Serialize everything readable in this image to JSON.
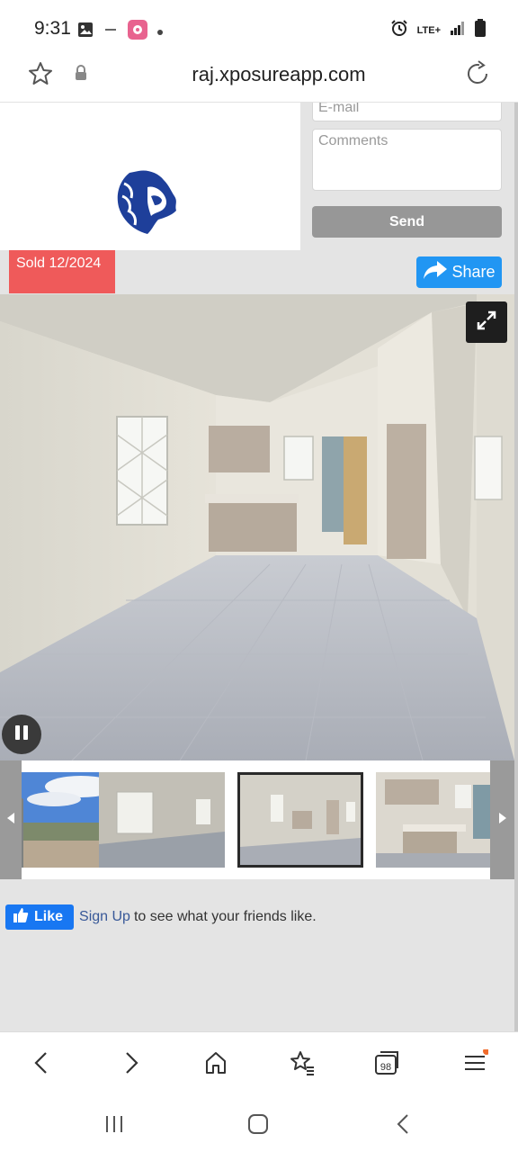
{
  "status_bar": {
    "time": "9:31",
    "network": "LTE+",
    "icons": [
      "image-icon",
      "minus-icon",
      "flower-app-icon",
      "dot-icon",
      "alarm-icon",
      "signal-icon",
      "battery-icon"
    ]
  },
  "address_bar": {
    "url": "raj.xposureapp.com",
    "icons": [
      "star-icon",
      "lock-icon",
      "reload-icon"
    ]
  },
  "contact_form": {
    "email_placeholder": "E-mail",
    "comments_placeholder": "Comments",
    "send_label": "Send"
  },
  "listing": {
    "status_badge": "Sold 12/2024",
    "share_label": "Share"
  },
  "gallery": {
    "thumbnails": [
      "exterior",
      "room-window",
      "kitchen-room",
      "kitchen"
    ],
    "active_thumbnail_index": 2
  },
  "facebook": {
    "like_label": "Like",
    "signup_label": "Sign Up",
    "signup_text": "to see what your friends like."
  },
  "bottom_bar": {
    "tabs_count": "98",
    "icons": [
      "back-icon",
      "forward-icon",
      "home-icon",
      "bookmarks-icon",
      "tabs-icon",
      "menu-icon"
    ]
  },
  "colors": {
    "sold_badge": "#ef5a5a",
    "share_button": "#2196f3",
    "facebook_blue": "#1877f2",
    "send_button": "#979797",
    "logo_blue": "#1e3f9a"
  }
}
